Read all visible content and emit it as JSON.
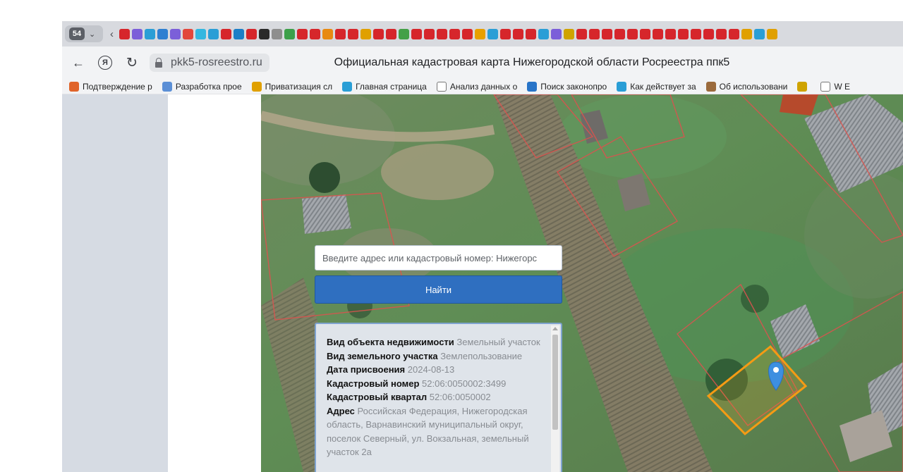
{
  "browser": {
    "tab_count": "54",
    "url": "pkk5-rosreestro.ru",
    "page_title": "Официальная кадастровая карта Нижегородской области Росреестра ппк5",
    "tab_icon_colors": [
      "#d6262b",
      "#7b5fd9",
      "#2a9ed6",
      "#2e7fd1",
      "#7b5fd9",
      "#e2473c",
      "#33b7e0",
      "#2a9ed6",
      "#d6262b",
      "#1c7fc7",
      "#d6262b",
      "#2a2a2a",
      "#8e8e8e",
      "#3da04a",
      "#d6262b",
      "#d6262b",
      "#e88a12",
      "#d6262b",
      "#d6262b",
      "#e0a000",
      "#d6262b",
      "#d6262b",
      "#43a047",
      "#d6262b",
      "#d6262b",
      "#d6262b",
      "#d6262b",
      "#d6262b",
      "#e8a000",
      "#2a9ed6",
      "#d6262b",
      "#d6262b",
      "#d6262b",
      "#2a9ed6",
      "#7b5fd9",
      "#cfa300",
      "#d6262b",
      "#d6262b",
      "#d6262b",
      "#d6262b",
      "#d6262b",
      "#d6262b",
      "#d6262b",
      "#d6262b",
      "#d6262b",
      "#d6262b",
      "#d6262b",
      "#d6262b",
      "#d6262b",
      "#e0a000",
      "#2a9ed6",
      "#e0a000"
    ]
  },
  "bookmarks": [
    {
      "label": "Подтверждение р",
      "color": "#e0642a"
    },
    {
      "label": "Разработка прое",
      "color": "#5b8fd6"
    },
    {
      "label": "Приватизация сл",
      "color": "#e0a000"
    },
    {
      "label": "Главная страница",
      "color": "#2a9ed6"
    },
    {
      "label": "Анализ данных о",
      "color": "#ffffff"
    },
    {
      "label": "Поиск законопро",
      "color": "#2874c8"
    },
    {
      "label": "Как действует за",
      "color": "#2a9ed6"
    },
    {
      "label": "Об использовани",
      "color": "#9b6a3c"
    },
    {
      "label": "",
      "color": "#cfa300"
    },
    {
      "label": "W E",
      "color": "#ffffff"
    }
  ],
  "search": {
    "placeholder": "Введите адрес или кадастровый номер: Нижегорс",
    "button_label": "Найти"
  },
  "info": {
    "rows": [
      {
        "label": "Вид объекта недвижимости",
        "value": "Земельный участок"
      },
      {
        "label": "Вид земельного участка",
        "value": "Землепользование"
      },
      {
        "label": "Дата присвоения",
        "value": "2024-08-13"
      },
      {
        "label": "Кадастровый номер",
        "value": "52:06:0050002:3499"
      },
      {
        "label": "Кадастровый квартал",
        "value": "52:06:0050002"
      },
      {
        "label": "Адрес",
        "value": "Российская Федерация, Нижегородская область, Варнавинский муниципальный округ, поселок Северный, ул. Вокзальная, земельный участок 2а"
      }
    ]
  },
  "map": {
    "highlight_color": "#f59b14",
    "parcel_border_color": "#d9534f",
    "marker_color": "#3d8fe0"
  }
}
